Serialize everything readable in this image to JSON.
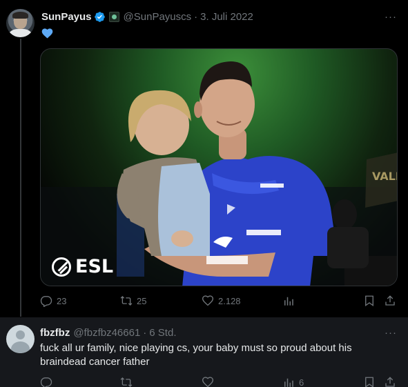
{
  "main_tweet": {
    "author_name": "SunPayus",
    "handle": "@SunPayuscs",
    "separator": "·",
    "date": "3. Juli 2022",
    "more_label": "···",
    "body_icon": "blue-heart-icon",
    "media": {
      "watermark_text": "ESL"
    },
    "actions": {
      "replies": "23",
      "retweets": "25",
      "likes": "2.128"
    }
  },
  "reply_tweet": {
    "author_name": "fbzfbz",
    "handle": "@fbzfbz46661",
    "separator": "·",
    "time": "6 Std.",
    "more_label": "···",
    "text": "fuck all ur family, nice playing cs, your baby must so proud about his braindead cancer father",
    "actions": {
      "views": "6"
    }
  },
  "colors": {
    "background": "#000000",
    "reply_background": "#16181c",
    "text_primary": "#e7e9ea",
    "text_secondary": "#71767b",
    "verified_blue": "#1d9bf0",
    "heart_blue": "#5ea9f5"
  }
}
